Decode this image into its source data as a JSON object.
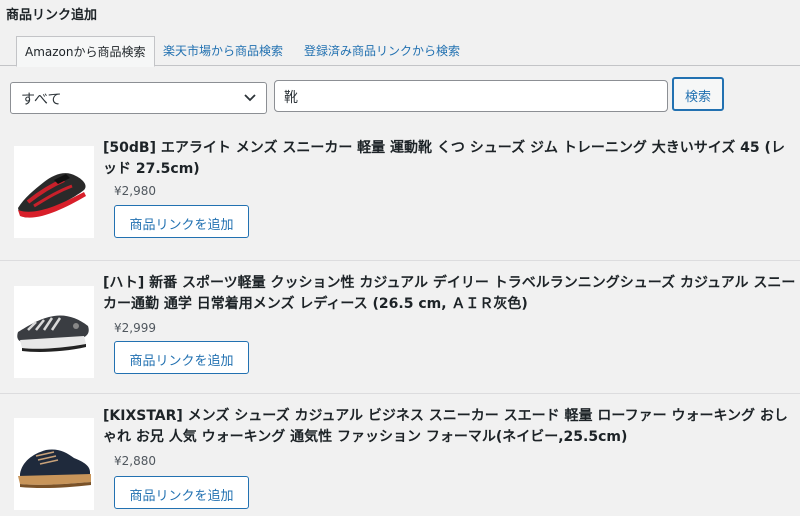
{
  "header": {
    "title": "商品リンク追加"
  },
  "tabs": [
    {
      "label": "Amazonから商品検索",
      "active": true
    },
    {
      "label": "楽天市場から商品検索",
      "active": false
    },
    {
      "label": "登録済み商品リンクから検索",
      "active": false
    }
  ],
  "search": {
    "category_value": "すべて",
    "query_value": "靴",
    "button_label": "検索"
  },
  "results": [
    {
      "name": "[50dB] エアライト メンズ スニーカー 軽量 運動靴 くつ シューズ ジム トレーニング 大きいサイズ 45 (レッド 27.5cm)",
      "price": "¥2,980",
      "add_label": "商品リンクを追加",
      "thumb_icon": "red-black-sneaker-image"
    },
    {
      "name": "[ハト] 新番 スポーツ軽量 クッション性 カジュアル デイリー トラベルランニングシューズ カジュアル スニーカー通勤 通学 日常着用メンズ レディース (26.5 cm, ＡＩＲ灰色)",
      "price": "¥2,999",
      "add_label": "商品リンクを追加",
      "thumb_icon": "gray-running-shoe-image"
    },
    {
      "name": "[KIXSTAR] メンズ シューズ カジュアル ビジネス スニーカー スエード 軽量 ローファー ウォーキング おしゃれ お兄 人気 ウォーキング 通気性 ファッション フォーマル(ネイビー,25.5cm)",
      "price": "¥2,880",
      "add_label": "商品リンクを追加",
      "thumb_icon": "navy-suede-shoe-image"
    }
  ],
  "colors": {
    "accent": "#2271b1",
    "background": "#f1f1f1",
    "border": "#c3c4c7"
  }
}
